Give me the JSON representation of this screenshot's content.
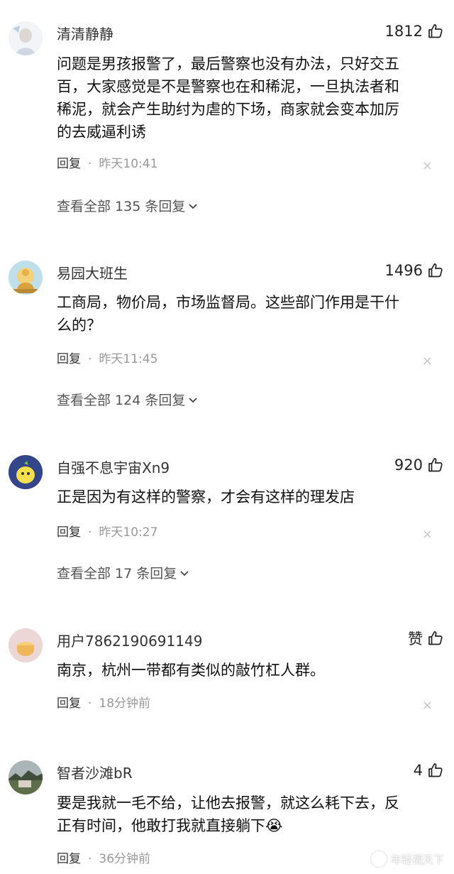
{
  "comments": [
    {
      "username": "清清静静",
      "likes": "1812",
      "text": "问题是男孩报警了，最后警察也没有办法，只好交五\n百，大家感觉是不是警察也在和稀泥，一旦执法者和\n稀泥，就会产生助纣为虐的下场，商家就会变本加厉\n的去威逼利诱",
      "reply_label": "回复",
      "separator": "·",
      "time": "昨天10:41",
      "view_all": "查看全部 135 条回复"
    },
    {
      "username": "易园大班生",
      "likes": "1496",
      "text": "工商局，物价局，市场监督局。这些部门作用是干什\n么的？",
      "reply_label": "回复",
      "separator": "·",
      "time": "昨天11:45",
      "view_all": "查看全部 124 条回复"
    },
    {
      "username": "自强不息宇宙Xn9",
      "likes": "920",
      "text": "正是因为有这样的警察，才会有这样的理发店",
      "reply_label": "回复",
      "separator": "·",
      "time": "昨天10:27",
      "view_all": "查看全部 17 条回复"
    },
    {
      "username": "用户7862190691149",
      "likes": "赞",
      "text": "南京，杭州一带都有类似的敲竹杠人群。",
      "reply_label": "回复",
      "separator": "·",
      "time": "18分钟前"
    },
    {
      "username": "智者沙滩bR",
      "likes": "4",
      "text": "要是我就一毛不给，让他去报警，就这么耗下去，反\n正有时间，他敢打我就直接躺下😭",
      "reply_label": "回复",
      "separator": "·",
      "time": "36分钟前"
    }
  ],
  "icons": {
    "like": "thumbs-up-icon",
    "close": "close-icon",
    "expand": "chevron-down-icon"
  },
  "close_glyph": "×",
  "watermark": "年轻视天下"
}
